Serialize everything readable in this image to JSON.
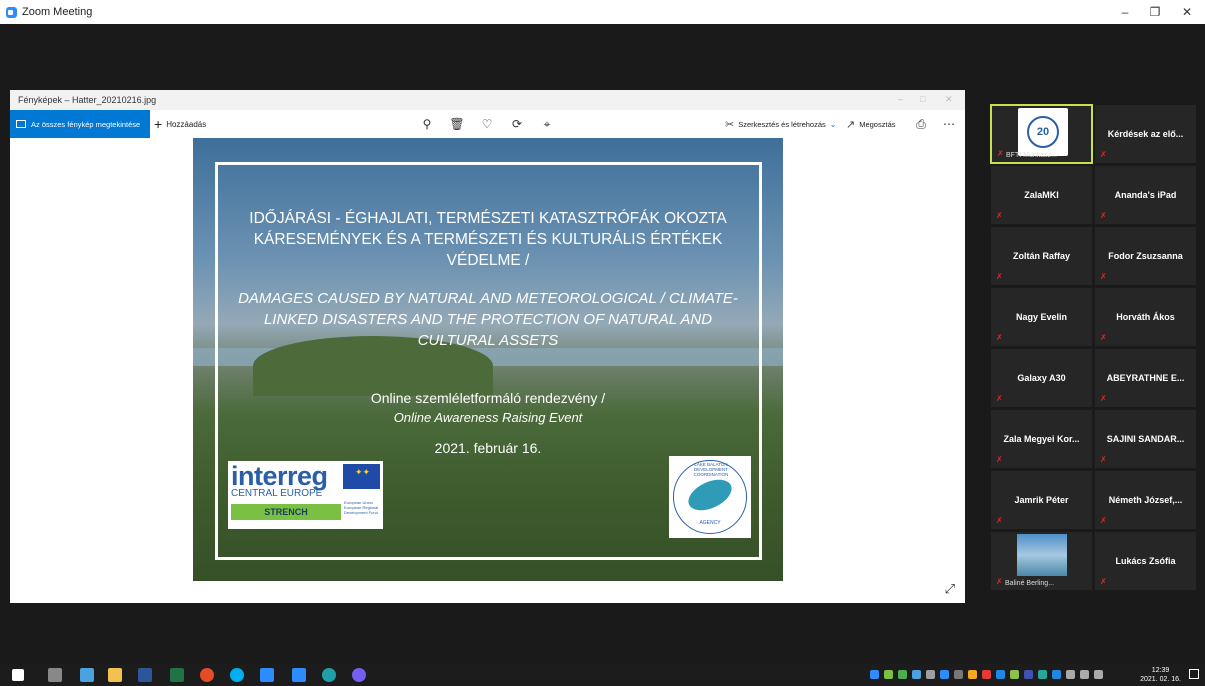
{
  "window": {
    "title": "Zoom Meeting"
  },
  "photos": {
    "title": "Fényképek – Hatter_20210216.jpg",
    "all_photos": "Az összes fénykép megtekintése",
    "add": "Hozzáadás",
    "edit_create": "Szerkesztés és létrehozás",
    "share": "Megosztás"
  },
  "slide": {
    "hu_title": "IDŐJÁRÁSI - ÉGHAJLATI, TERMÉSZETI KATASZTRÓFÁK OKOZTA KÁRESEMÉNYEK ÉS A TERMÉSZETI ÉS KULTURÁLIS ÉRTÉKEK VÉDELME /",
    "en_title": "DAMAGES CAUSED BY NATURAL AND METEOROLOGICAL / CLIMATE-LINKED DISASTERS AND THE PROTECTION OF NATURAL AND CULTURAL ASSETS",
    "event_hu": "Online szemléletformáló rendezvény /",
    "event_en": "Online Awareness Raising Event",
    "date": "2021. február 16.",
    "interreg": "interreg",
    "central_europe": "CENTRAL EUROPE",
    "strench": "STRENCH",
    "fund": "European Union European Regional Development Fund",
    "lbdc_ring": "LAKE BALATON DEVELOPMENT COORDINATION",
    "lbdc_agency": "AGENCY"
  },
  "participants": [
    {
      "name": "BFTI Munkasz...",
      "logo_text": "20"
    },
    {
      "name": "Kérdések az elő..."
    },
    {
      "name": "ZalaMKI"
    },
    {
      "name": "Ananda's iPad"
    },
    {
      "name": "Zoltán Raffay"
    },
    {
      "name": "Fodor Zsuzsanna"
    },
    {
      "name": "Nagy Evelin"
    },
    {
      "name": "Horváth Ákos"
    },
    {
      "name": "Galaxy A30"
    },
    {
      "name": "ABEYRATHNE E..."
    },
    {
      "name": "Zala Megyei Kor..."
    },
    {
      "name": "SAJINI SANDAR..."
    },
    {
      "name": "Jamrik Péter"
    },
    {
      "name": "Németh József,..."
    },
    {
      "name": "Baliné Berling..."
    },
    {
      "name": "Lukács Zsófia"
    }
  ],
  "taskbar": {
    "time": "12:39",
    "date": "2021. 02. 16."
  }
}
